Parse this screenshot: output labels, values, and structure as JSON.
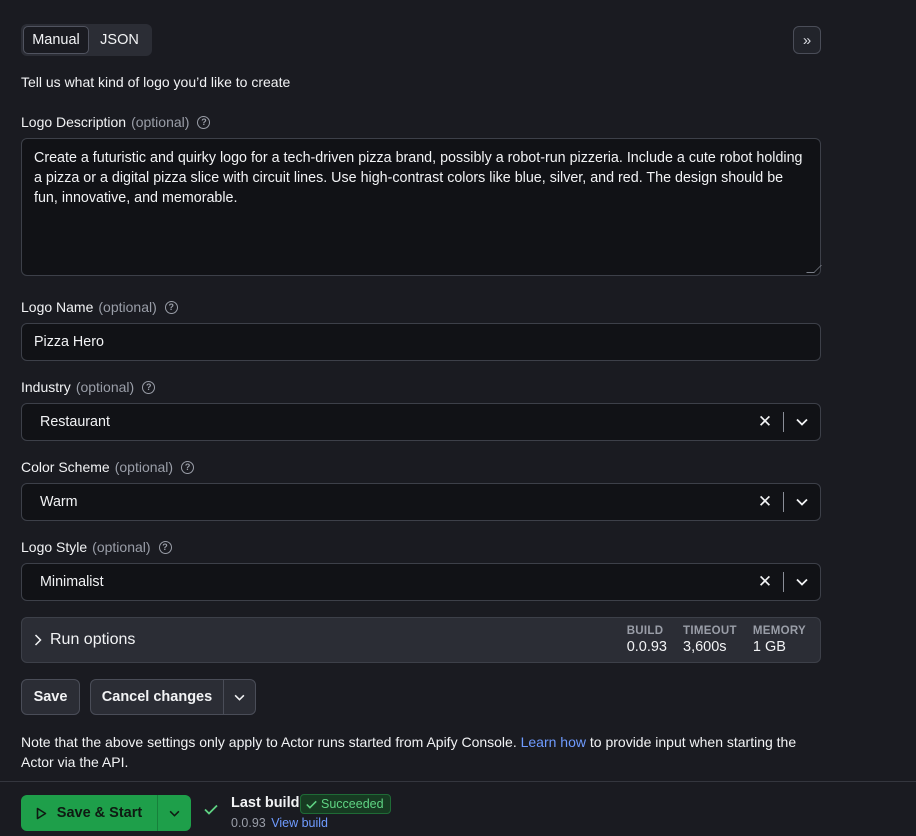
{
  "tabs": {
    "manual": "Manual",
    "json": "JSON"
  },
  "collapse_icon": "double-chevron-right",
  "intro": "Tell us what kind of logo you’d like to create",
  "fields": {
    "description": {
      "label": "Logo Description",
      "optional": "(optional)",
      "value": "Create a futuristic and quirky logo for a tech-driven pizza brand, possibly a robot-run pizzeria. Include a cute robot holding a pizza or a digital pizza slice with circuit lines. Use high-contrast colors like blue, silver, and red. The design should be fun, innovative, and memorable."
    },
    "name": {
      "label": "Logo Name",
      "optional": "(optional)",
      "value": "Pizza Hero"
    },
    "industry": {
      "label": "Industry",
      "optional": "(optional)",
      "value": "Restaurant"
    },
    "color_scheme": {
      "label": "Color Scheme",
      "optional": "(optional)",
      "value": "Warm"
    },
    "style": {
      "label": "Logo Style",
      "optional": "(optional)",
      "value": "Minimalist"
    }
  },
  "run_options": {
    "label": "Run options",
    "build_label": "BUILD",
    "build_value": "0.0.93",
    "timeout_label": "TIMEOUT",
    "timeout_value": "3,600s",
    "memory_label": "MEMORY",
    "memory_value": "1 GB"
  },
  "actions": {
    "save": "Save",
    "cancel": "Cancel changes"
  },
  "note": {
    "before": "Note that the above settings only apply to Actor runs started from Apify Console. ",
    "link": "Learn how",
    "after": " to provide input when starting the Actor via the API."
  },
  "footer": {
    "start": "Save & Start",
    "last_build": "Last build",
    "status": "Succeeded",
    "version": "0.0.93",
    "view_build": "View build"
  },
  "colors": {
    "background": "#1a1b21",
    "accent_green": "#1e9f4a",
    "link_blue": "#6f9bff",
    "success_text": "#5fd383"
  }
}
